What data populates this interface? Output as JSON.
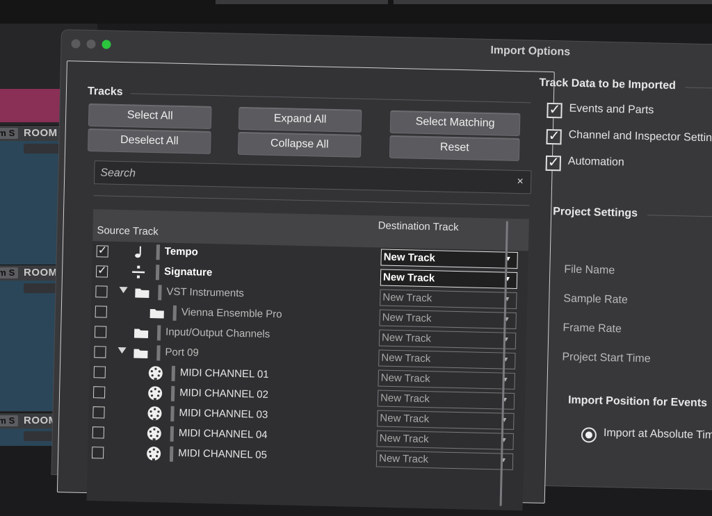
{
  "background": {
    "track_name_partial": "ROOM",
    "mute_label": "m",
    "solo_label": "S"
  },
  "window": {
    "title": "Import Options"
  },
  "tracks_section": {
    "title": "Tracks",
    "buttons": {
      "select_all": "Select All",
      "deselect_all": "Deselect All",
      "expand_all": "Expand All",
      "collapse_all": "Collapse All",
      "select_matching": "Select Matching",
      "reset": "Reset"
    },
    "search_placeholder": "Search",
    "search_clear": "×",
    "columns": {
      "source": "Source Track",
      "destination": "Destination Track"
    },
    "rows": [
      {
        "name": "Tempo",
        "checked": true,
        "icon": "tempo-note-icon",
        "destination": "New Track"
      },
      {
        "name": "Signature",
        "checked": true,
        "icon": "signature-icon",
        "destination": "New Track"
      },
      {
        "name": "VST Instruments",
        "checked": false,
        "icon": "folder-icon",
        "expanded": true,
        "destination": "New Track"
      },
      {
        "name": "Vienna Ensemble Pro",
        "checked": false,
        "icon": "folder-icon",
        "destination": "New Track"
      },
      {
        "name": "Input/Output Channels",
        "checked": false,
        "icon": "folder-icon",
        "destination": "New Track"
      },
      {
        "name": "Port 09",
        "checked": false,
        "icon": "folder-icon",
        "expanded": true,
        "destination": "New Track"
      },
      {
        "name": "MIDI CHANNEL 01",
        "checked": false,
        "icon": "midi-connector-icon",
        "destination": "New Track"
      },
      {
        "name": "MIDI CHANNEL 02",
        "checked": false,
        "icon": "midi-connector-icon",
        "destination": "New Track"
      },
      {
        "name": "MIDI CHANNEL 03",
        "checked": false,
        "icon": "midi-connector-icon",
        "destination": "New Track"
      },
      {
        "name": "MIDI CHANNEL 04",
        "checked": false,
        "icon": "midi-connector-icon",
        "destination": "New Track"
      },
      {
        "name": "MIDI CHANNEL 05",
        "checked": false,
        "icon": "midi-connector-icon",
        "destination": "New Track"
      }
    ]
  },
  "track_data": {
    "title": "Track Data to be Imported",
    "options": [
      {
        "label": "Events and Parts",
        "checked": true
      },
      {
        "label": "Channel and Inspector Settings",
        "checked": true
      },
      {
        "label": "Automation",
        "checked": true
      }
    ]
  },
  "project_settings": {
    "title": "Project Settings",
    "fields": [
      "File Name",
      "Sample Rate",
      "Frame Rate",
      "Project Start Time"
    ]
  },
  "import_position": {
    "title": "Import Position for Events",
    "selected_option": "Import at Absolute Time"
  }
}
